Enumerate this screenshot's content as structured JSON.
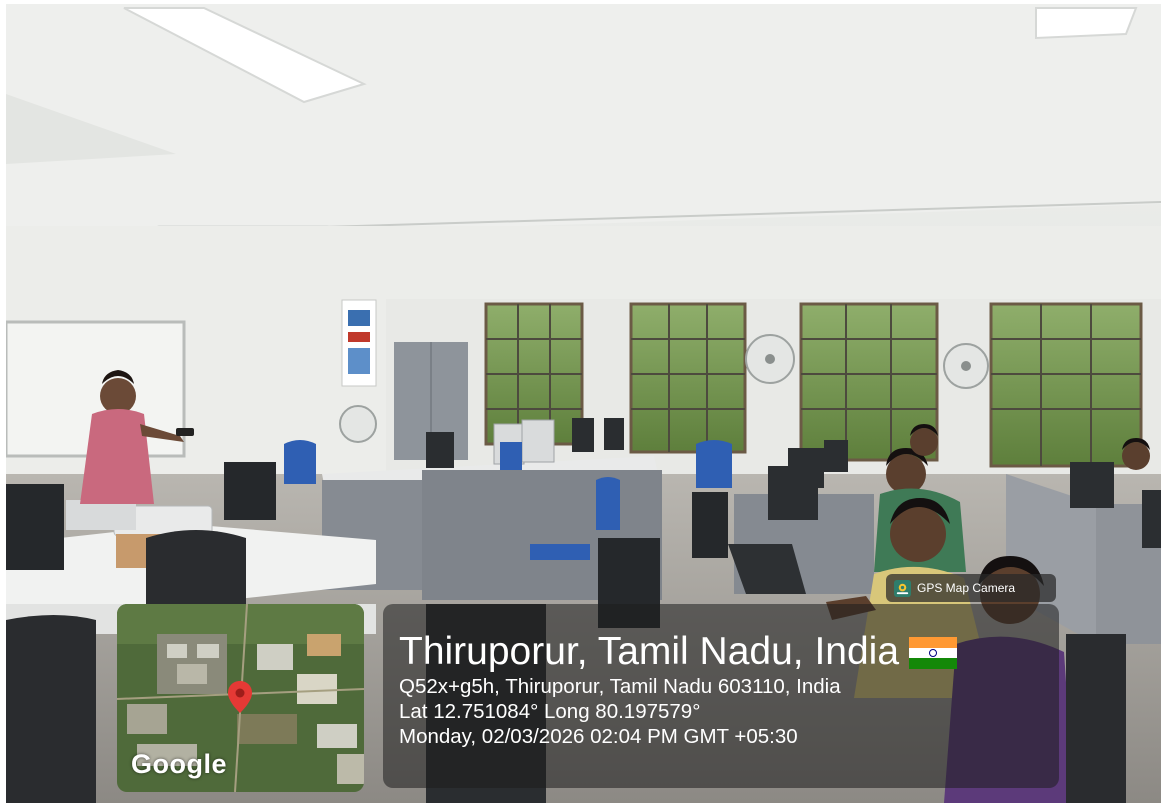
{
  "overlay": {
    "badge_label": "GPS Map Camera",
    "location_title": "Thiruporur, Tamil Nadu, India",
    "address": "Q52x+g5h, Thiruporur, Tamil Nadu 603110, India",
    "coordinates": "Lat 12.751084° Long 80.197579°",
    "datetime": "Monday, 02/03/2026 02:04 PM GMT +05:30",
    "map_brand": "Google",
    "flag_icon": "india-flag-icon",
    "pin_icon": "map-pin-icon"
  },
  "colors": {
    "wall": "#ecedea",
    "ceiling": "#f4f5f3",
    "furniture_grey": "#8d9198",
    "chair_blue": "#2f5fb3",
    "foliage": "#6f8f48",
    "pin_red": "#e53935"
  }
}
